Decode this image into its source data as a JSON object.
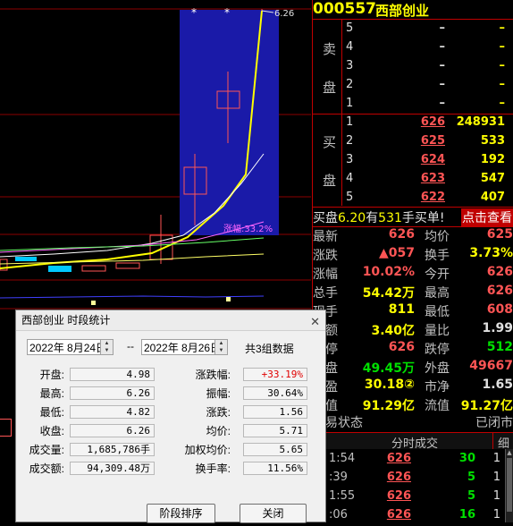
{
  "chart": {
    "pct_label": "涨幅:33.2%",
    "high_label": "6.26"
  },
  "stock": {
    "code": "000557",
    "name": "西部创业"
  },
  "sell_side_label": [
    "卖",
    "盘"
  ],
  "buy_side_label": [
    "买",
    "盘"
  ],
  "sell_orders": [
    {
      "level": "5",
      "price": "–",
      "volume": "–"
    },
    {
      "level": "4",
      "price": "–",
      "volume": "–"
    },
    {
      "level": "3",
      "price": "–",
      "volume": "–"
    },
    {
      "level": "2",
      "price": "–",
      "volume": "–"
    },
    {
      "level": "1",
      "price": "–",
      "volume": "–"
    }
  ],
  "buy_orders": [
    {
      "level": "1",
      "price": "626",
      "volume": "248931"
    },
    {
      "level": "2",
      "price": "625",
      "volume": "533"
    },
    {
      "level": "3",
      "price": "624",
      "volume": "192"
    },
    {
      "level": "4",
      "price": "623",
      "volume": "547"
    },
    {
      "level": "5",
      "price": "622",
      "volume": "407"
    }
  ],
  "banner": {
    "p1": "买盘",
    "price": "6.20",
    "p2": "有",
    "qty": "531",
    "p3": "手买单!",
    "link": "点击查看"
  },
  "stats": [
    {
      "l1": "最新",
      "v1": "626",
      "c1": "red",
      "l2": "均价",
      "v2": "625",
      "c2": "red"
    },
    {
      "l1": "涨跌",
      "v1": "▲057",
      "c1": "red",
      "l2": "换手",
      "v2": "3.73%",
      "c2": "yellow"
    },
    {
      "l1": "涨幅",
      "v1": "10.02%",
      "c1": "red",
      "l2": "今开",
      "v2": "626",
      "c2": "red"
    },
    {
      "l1": "总手",
      "v1": "54.42万",
      "c1": "yellow",
      "l2": "最高",
      "v2": "626",
      "c2": "red"
    },
    {
      "l1": "现手",
      "v1": "811",
      "c1": "yellow",
      "l2": "最低",
      "v2": "608",
      "c2": "red"
    },
    {
      "l1": "金额",
      "v1": "3.40亿",
      "c1": "yellow",
      "l2": "量比",
      "v2": "1.99",
      "c2": "white"
    },
    {
      "l1": "涨停",
      "v1": "626",
      "c1": "red",
      "l2": "跌停",
      "v2": "512",
      "c2": "green"
    },
    {
      "l1": "内盘",
      "v1": "49.45万",
      "c1": "green",
      "l2": "外盘",
      "v2": "49667",
      "c2": "red"
    },
    {
      "l1": "市盈",
      "v1": "30.18②",
      "c1": "yellow",
      "l2": "市净",
      "v2": "1.65",
      "c2": "white"
    },
    {
      "l1": "总值",
      "v1": "91.29亿",
      "c1": "yellow",
      "l2": "流值",
      "v2": "91.27亿",
      "c2": "yellow"
    }
  ],
  "status": {
    "label": "交易状态",
    "value": "已闭市"
  },
  "ticks_header": {
    "title": "分时成交",
    "btn": "细"
  },
  "ticks": [
    {
      "time": "1:54",
      "price": "626",
      "vol": "30",
      "n": "1"
    },
    {
      "time": ":39",
      "price": "626",
      "vol": "5",
      "n": "1"
    },
    {
      "time": "1:55",
      "price": "626",
      "vol": "5",
      "n": "1"
    },
    {
      "time": ":06",
      "price": "626",
      "vol": "16",
      "n": "1"
    }
  ],
  "dialog": {
    "title": "西部创业  时段统计",
    "start_date": "2022年  8月24日",
    "sep": "--",
    "end_date": "2022年  8月26日",
    "count": "共3组数据",
    "fields_left": [
      {
        "label": "开盘:",
        "value": "4.98"
      },
      {
        "label": "最高:",
        "value": "6.26"
      },
      {
        "label": "最低:",
        "value": "4.82"
      },
      {
        "label": "收盘:",
        "value": "6.26"
      },
      {
        "label": "成交量:",
        "value": "1,685,786手"
      },
      {
        "label": "成交额:",
        "value": "94,309.48万"
      }
    ],
    "fields_right": [
      {
        "label": "涨跌幅:",
        "value": "+33.19%"
      },
      {
        "label": "振幅:",
        "value": "30.64%"
      },
      {
        "label": "涨跌:",
        "value": "1.56"
      },
      {
        "label": "均价:",
        "value": "5.71"
      },
      {
        "label": "加权均价:",
        "value": "5.65"
      },
      {
        "label": "换手率:",
        "value": "11.56%"
      }
    ],
    "btn_rank": "阶段排序",
    "btn_close": "关闭"
  },
  "colors": {
    "up": "#ff5555",
    "down": "#00e000",
    "accent": "#ffff00",
    "grid": "#c00000"
  }
}
